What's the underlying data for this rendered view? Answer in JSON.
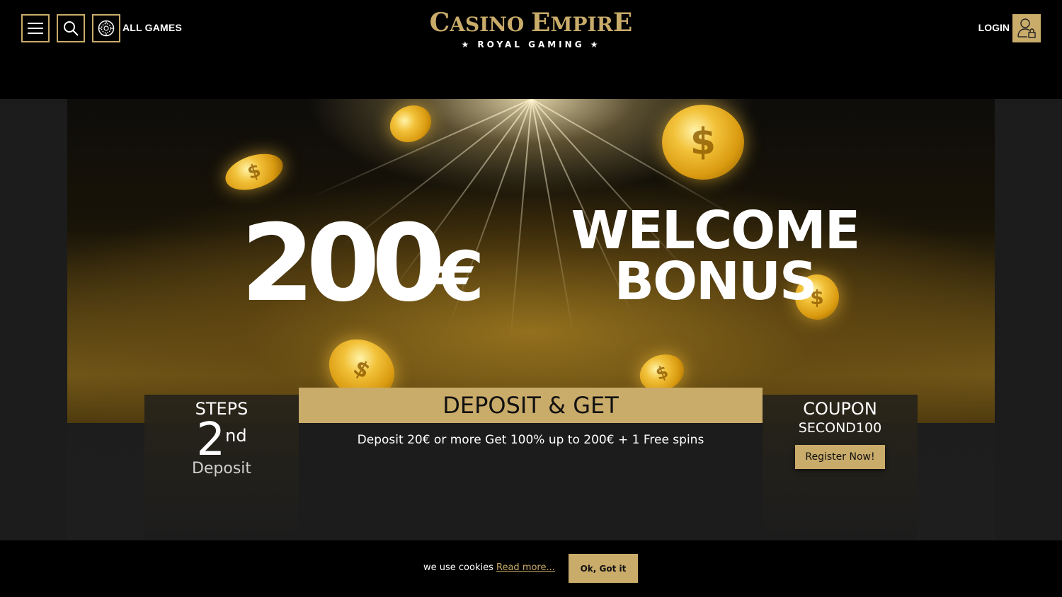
{
  "header": {
    "all_games_label": "ALL GAMES",
    "logo_main_big_c": "C",
    "logo_main_rest1": "ASINO ",
    "logo_main_big_e": "E",
    "logo_main_rest2": "MPIR",
    "logo_main_big_e2": "E",
    "logo_sub": "★ ROYAL GAMING ★",
    "login_label": "LOGIN",
    "icons": [
      "menu-icon",
      "search-icon",
      "roulette-chip-icon",
      "user-lock-icon"
    ]
  },
  "banner": {
    "amount": "200",
    "currency": "€",
    "welcome_line1": "WELCOME",
    "welcome_line2": "BONUS"
  },
  "steps": {
    "title": "STEPS",
    "number": "2",
    "suffix": "nd",
    "subtitle": "Deposit"
  },
  "offer": {
    "heading": "DEPOSIT & GET",
    "text": "Deposit 20€ or more Get 100% up to 200€ + 1 Free spins"
  },
  "coupon": {
    "title": "COUPON",
    "code": "SECOND100",
    "register_label": "Register Now!"
  },
  "cookie": {
    "text": "we use cookies ",
    "link_label": "Read more...",
    "ok_label": "Ok, Got it"
  },
  "colors": {
    "accent_gold": "#c9ab6a",
    "background": "#000000",
    "panel": "#1c1c1c"
  }
}
